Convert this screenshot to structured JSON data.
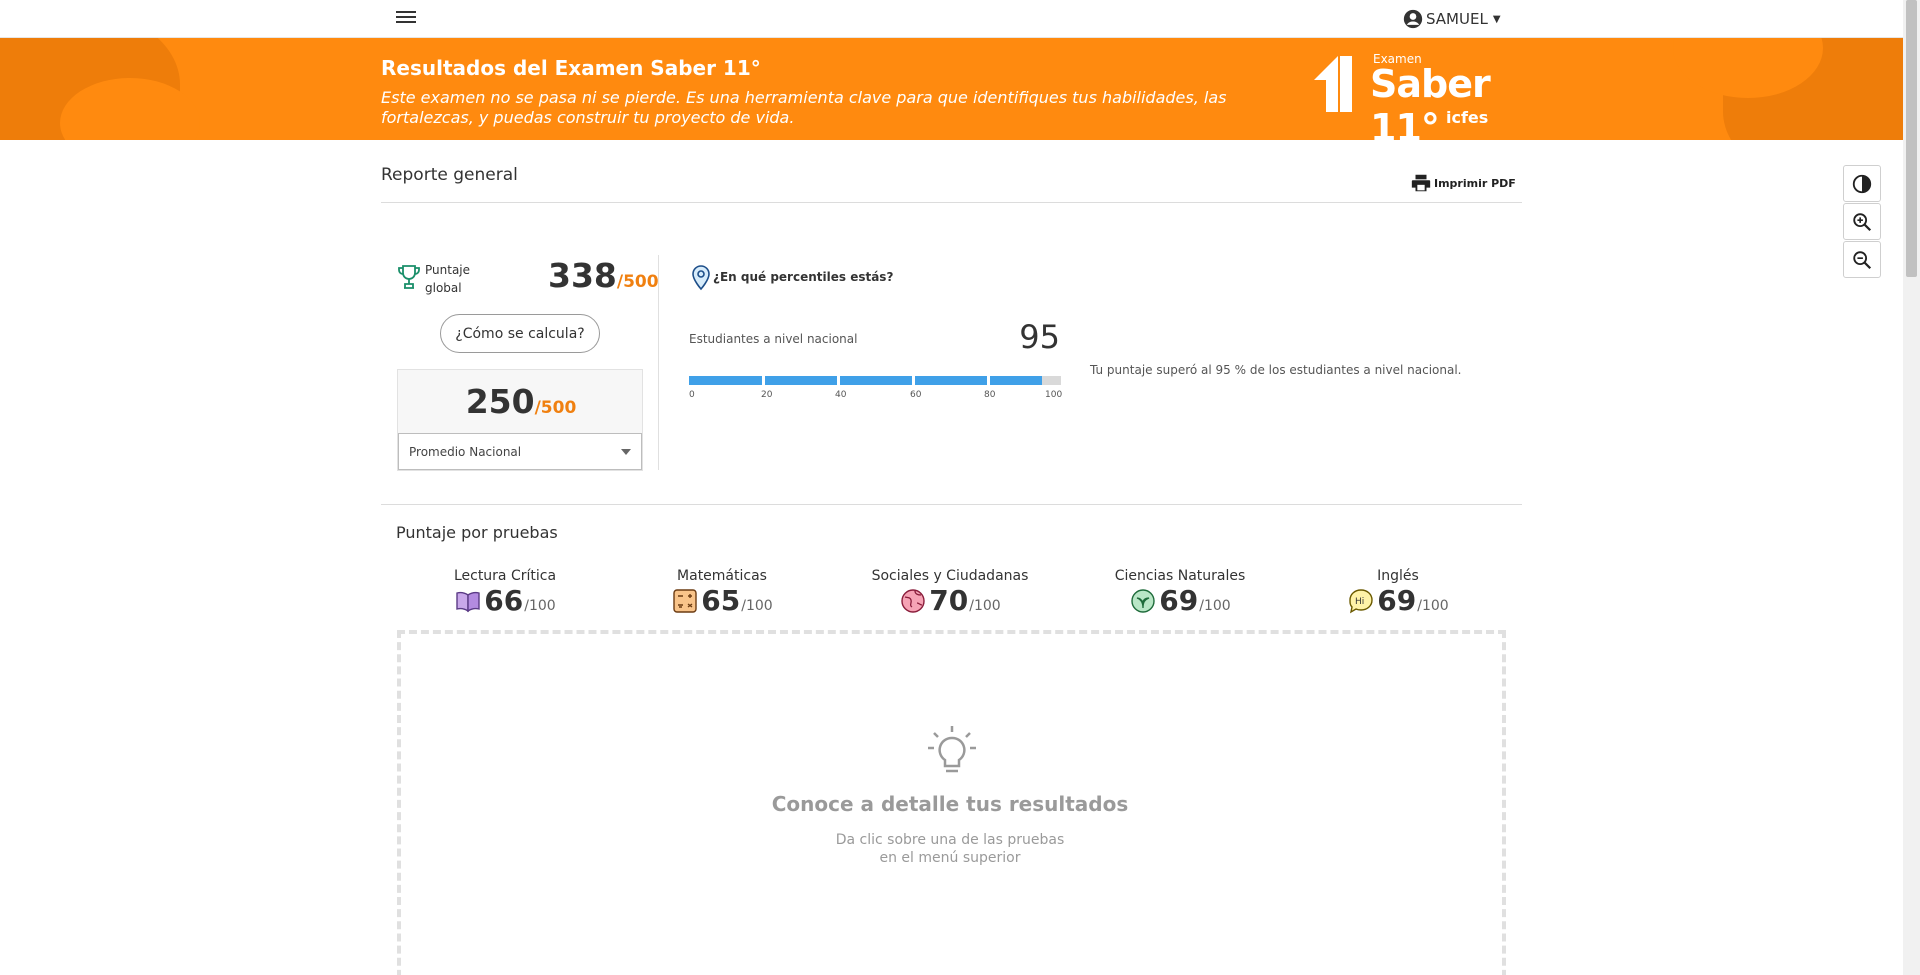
{
  "nav": {
    "user_name": "SAMUEL"
  },
  "banner": {
    "title": "Resultados del Examen Saber 11°",
    "subtitle": "Este examen no se pasa ni se pierde. Es una herramienta clave para que identifiques tus habilidades, las fortalezcas, y puedas construir tu proyecto de vida.",
    "logo_examen": "Examen",
    "logo_saber": "Saber 11°",
    "logo_icfes": "icfes"
  },
  "report": {
    "title": "Reporte general",
    "print_label": "Imprimir PDF"
  },
  "global": {
    "label": "Puntaje global",
    "score": "338",
    "max": "/500",
    "calc_button": "¿Cómo se calcula?",
    "average_score": "250",
    "average_max": "/500",
    "average_select_value": "Promedio Nacional"
  },
  "percentile": {
    "title": "¿En qué percentiles estás?",
    "label": "Estudiantes a nivel nacional",
    "value": "95",
    "fill_percent": 95,
    "ticks": [
      "0",
      "20",
      "40",
      "60",
      "80",
      "100"
    ],
    "description": "Tu puntaje superó al 95 % de los estudiantes a nivel nacional."
  },
  "tests": {
    "title": "Puntaje por pruebas",
    "items": [
      {
        "name": "Lectura Crítica",
        "score": "66",
        "max": "/100",
        "icon": "book-icon"
      },
      {
        "name": "Matemáticas",
        "score": "65",
        "max": "/100",
        "icon": "calculator-icon"
      },
      {
        "name": "Sociales y Ciudadanas",
        "score": "70",
        "max": "/100",
        "icon": "globe-icon"
      },
      {
        "name": "Ciencias Naturales",
        "score": "69",
        "max": "/100",
        "icon": "leaf-icon"
      },
      {
        "name": "Inglés",
        "score": "69",
        "max": "/100",
        "icon": "speech-bubble-icon"
      }
    ]
  },
  "detail": {
    "title": "Conoce a detalle tus resultados",
    "subtitle_line1": "Da clic sobre una de las pruebas",
    "subtitle_line2": "en el menú superior"
  },
  "colors": {
    "brand_orange": "#ff8a0f",
    "bar_blue": "#3fa0e8"
  }
}
